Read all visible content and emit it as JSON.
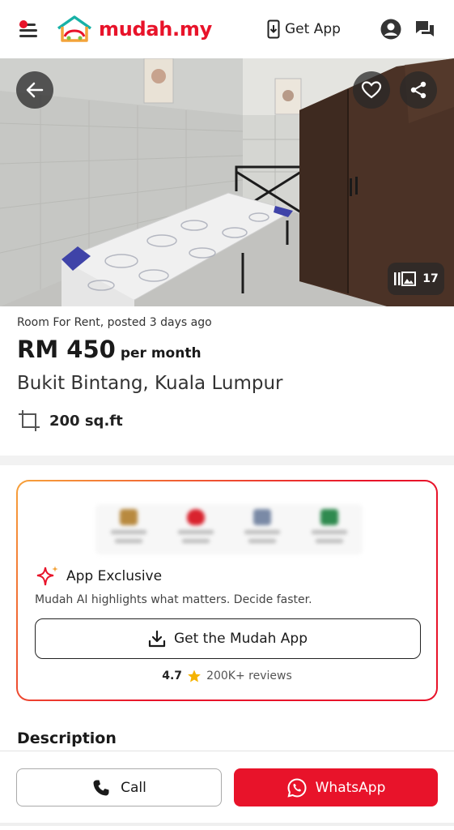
{
  "header": {
    "logo_text": "mudah.my",
    "get_app_label": "Get App",
    "brand_color": "#e8132a",
    "notification_dot": true
  },
  "hero": {
    "photo_count": "17",
    "icons": [
      "back-arrow-icon",
      "heart-icon",
      "share-icon",
      "gallery-icon"
    ]
  },
  "listing": {
    "subtitle": "Room For Rent, posted 3 days ago",
    "price": "RM 450",
    "price_unit": "per month",
    "location": "Bukit Bintang, Kuala Lumpur",
    "area": "200 sq.ft"
  },
  "app_exclusive": {
    "title": "App Exclusive",
    "description": "Mudah AI highlights what matters. Decide faster.",
    "button_label": "Get the Mudah App",
    "rating": "4.7",
    "reviews": "200K+ reviews"
  },
  "description": {
    "title": "Description"
  },
  "actions": {
    "call_label": "Call",
    "whatsapp_label": "WhatsApp"
  }
}
